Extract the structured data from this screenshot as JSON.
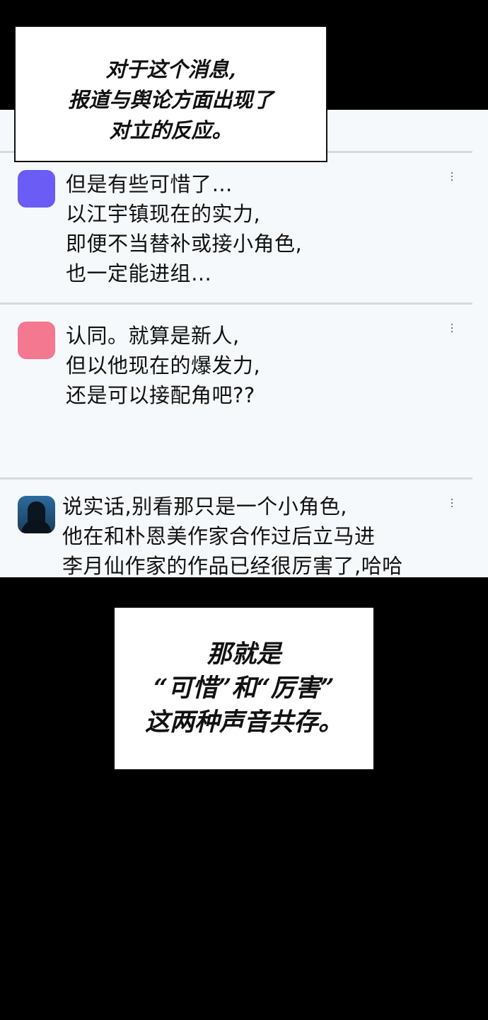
{
  "caption_top": {
    "lines": [
      "对于这个消息,",
      "报道与舆论方面出现了",
      "对立的反应。"
    ]
  },
  "comments": [
    {
      "avatar_color": "#6b5cf6",
      "lines": [
        "但是有些可惜了…",
        "以江宇镇现在的实力,",
        "即便不当替补或接小角色,",
        "也一定能进组…"
      ]
    },
    {
      "avatar_color": "#f47890",
      "lines": [
        "认同。就算是新人,",
        "但以他现在的爆发力,",
        "还是可以接配角吧??"
      ]
    },
    {
      "avatar_icon": "hooded-figure-avatar",
      "lines": [
        "说实话,别看那只是一个小角色,",
        "他在和朴恩美作家合作过后立马进",
        "李月仙作家的作品已经很厉害了,哈哈"
      ]
    }
  ],
  "caption_bottom": {
    "lines": [
      "那就是",
      "“可惜”和“厉害”",
      "这两种声音共存。"
    ]
  },
  "colors": {
    "background": "#000000",
    "panel": "#f6f9fc",
    "separator": "#d6dadf"
  }
}
